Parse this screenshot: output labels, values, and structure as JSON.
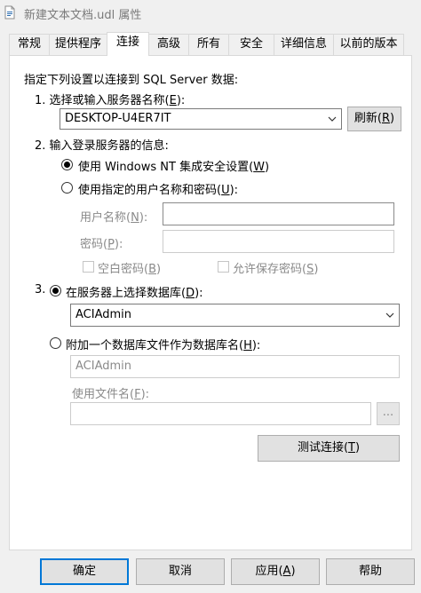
{
  "window": {
    "title": "新建文本文档.udl 属性"
  },
  "tabs": [
    {
      "label": "常规"
    },
    {
      "label": "提供程序"
    },
    {
      "label": "连接"
    },
    {
      "label": "高级"
    },
    {
      "label": "所有"
    },
    {
      "label": "安全"
    },
    {
      "label": "详细信息"
    },
    {
      "label": "以前的版本"
    }
  ],
  "connection": {
    "intro": "指定下列设置以连接到 SQL Server 数据:",
    "step1_label_pre": "1. 选择或输入服务器名称(",
    "step1_key": "E",
    "step1_label_post": "):",
    "server_value": "DESKTOP-U4ER7IT",
    "refresh_pre": "刷新(",
    "refresh_key": "R",
    "refresh_post": ")",
    "step2_label": "2. 输入登录服务器的信息:",
    "opt_windows_pre": "使用 Windows NT 集成安全设置(",
    "opt_windows_key": "W",
    "opt_windows_post": ")",
    "opt_user_pre": "使用指定的用户名称和密码(",
    "opt_user_key": "U",
    "opt_user_post": "):",
    "username_label_pre": "用户名称(",
    "username_key": "N",
    "username_label_post": "):",
    "username_value": "",
    "password_label_pre": "密码(",
    "password_key": "P",
    "password_label_post": "):",
    "password_value": "",
    "blank_pw_pre": "空白密码(",
    "blank_pw_key": "B",
    "blank_pw_post": ")",
    "allow_save_pre": "允许保存密码(",
    "allow_save_key": "S",
    "allow_save_post": ")",
    "step3_num": "3.",
    "opt_select_db_pre": "在服务器上选择数据库(",
    "opt_select_db_key": "D",
    "opt_select_db_post": "):",
    "db_value": "ACIAdmin",
    "opt_attach_pre": "附加一个数据库文件作为数据库名(",
    "opt_attach_key": "H",
    "opt_attach_post": "):",
    "attach_db_value": "ACIAdmin",
    "filename_label_pre": "使用文件名(",
    "filename_key": "F",
    "filename_label_post": "):",
    "filename_value": "",
    "browse_label": "...",
    "test_pre": "测试连接(",
    "test_key": "T",
    "test_post": ")"
  },
  "footer": {
    "ok": "确定",
    "cancel": "取消",
    "apply_pre": "应用(",
    "apply_key": "A",
    "apply_post": ")",
    "help": "帮助"
  },
  "icons": {
    "window": "udl-file-icon",
    "dropdown": "chevron-down-icon"
  }
}
